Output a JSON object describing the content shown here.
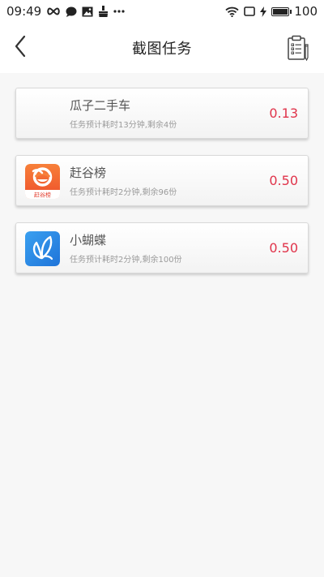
{
  "status_bar": {
    "time": "09:49",
    "battery_level": "100",
    "battery_fraction": 1.0,
    "icons": [
      "infinity-icon",
      "message-icon",
      "image-icon",
      "brush-icon",
      "more-icon",
      "wifi-icon",
      "screen-icon",
      "charging-icon",
      "battery-icon"
    ]
  },
  "header": {
    "title": "截图任务",
    "back_icon": "chevron-left-icon",
    "action_icon": "clipboard-icon"
  },
  "tasks": [
    {
      "name": "瓜子二手车",
      "description": "任务预计耗时13分钟,剩余4份",
      "reward": "0.13",
      "icon": "blank-app-icon"
    },
    {
      "name": "赶谷榜",
      "description": "任务预计耗时2分钟,剩余96份",
      "reward": "0.50",
      "icon": "ganguban-app-icon",
      "icon_caption": "赶谷榜"
    },
    {
      "name": "小蝴蝶",
      "description": "任务预计耗时2分钟,剩余100份",
      "reward": "0.50",
      "icon": "butterfly-app-icon"
    }
  ],
  "colors": {
    "reward": "#e0334a",
    "background": "#f7f7f7",
    "orange_icon": "#f26a2f",
    "blue_icon": "#2a8ae8"
  }
}
